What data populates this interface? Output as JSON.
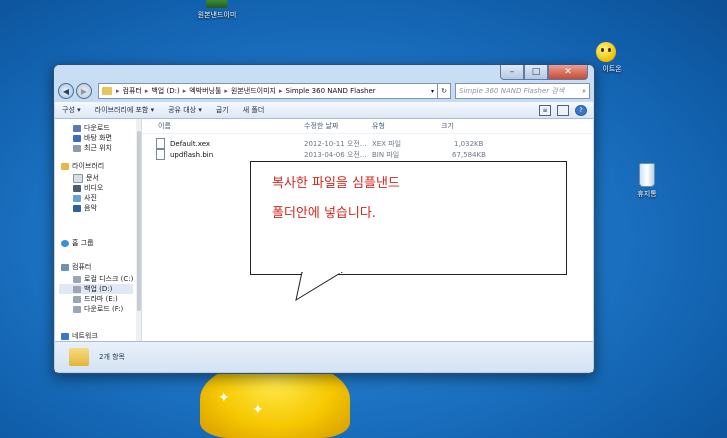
{
  "desktop": {
    "icons": [
      {
        "label": "원본낸드이미"
      },
      {
        "label": "이트온"
      },
      {
        "label": "휴지통"
      }
    ]
  },
  "window": {
    "address": {
      "crumbs": [
        "컴퓨터",
        "백업 (D:)",
        "엑박버닝툴",
        "원본낸드이미지",
        "Simple 360 NAND Flasher"
      ]
    },
    "search_placeholder": "Simple 360 NAND Flasher 검색",
    "toolbar": {
      "organize": "구성 ▾",
      "include_library": "라이브러리에 포함 ▾",
      "share": "공유 대상 ▾",
      "burn": "굽기",
      "new_folder": "새 폴더"
    },
    "nav": {
      "favorites": [
        "다운로드",
        "바탕 화면",
        "최근 위치"
      ],
      "libraries_title": "라이브러리",
      "libraries": [
        "문서",
        "비디오",
        "사진",
        "음악"
      ],
      "homegroup": "홈 그룹",
      "computer_title": "컴퓨터",
      "drives": [
        "로컬 디스크 (C:)",
        "백업 (D:)",
        "드라마 (E:)",
        "다운로드 (F:)"
      ],
      "network": "네트워크"
    },
    "columns": {
      "name": "이름",
      "modified": "수정한 날짜",
      "type": "유형",
      "size": "크기"
    },
    "files": [
      {
        "name": "Default.xex",
        "modified": "2012-10-11 오전...",
        "type": "XEX 파일",
        "size": "1,032KB"
      },
      {
        "name": "updflash.bin",
        "modified": "2013-04-06 오전...",
        "type": "BIN 파일",
        "size": "67,584KB"
      }
    ],
    "status": "2개 항목"
  },
  "callout": {
    "line1": "복사한 파일을 심플낸드",
    "line2": "폴더안에 넣습니다."
  },
  "colors": {
    "callout_text": "#d4261c",
    "desktop_bg": "#1f78c8"
  }
}
